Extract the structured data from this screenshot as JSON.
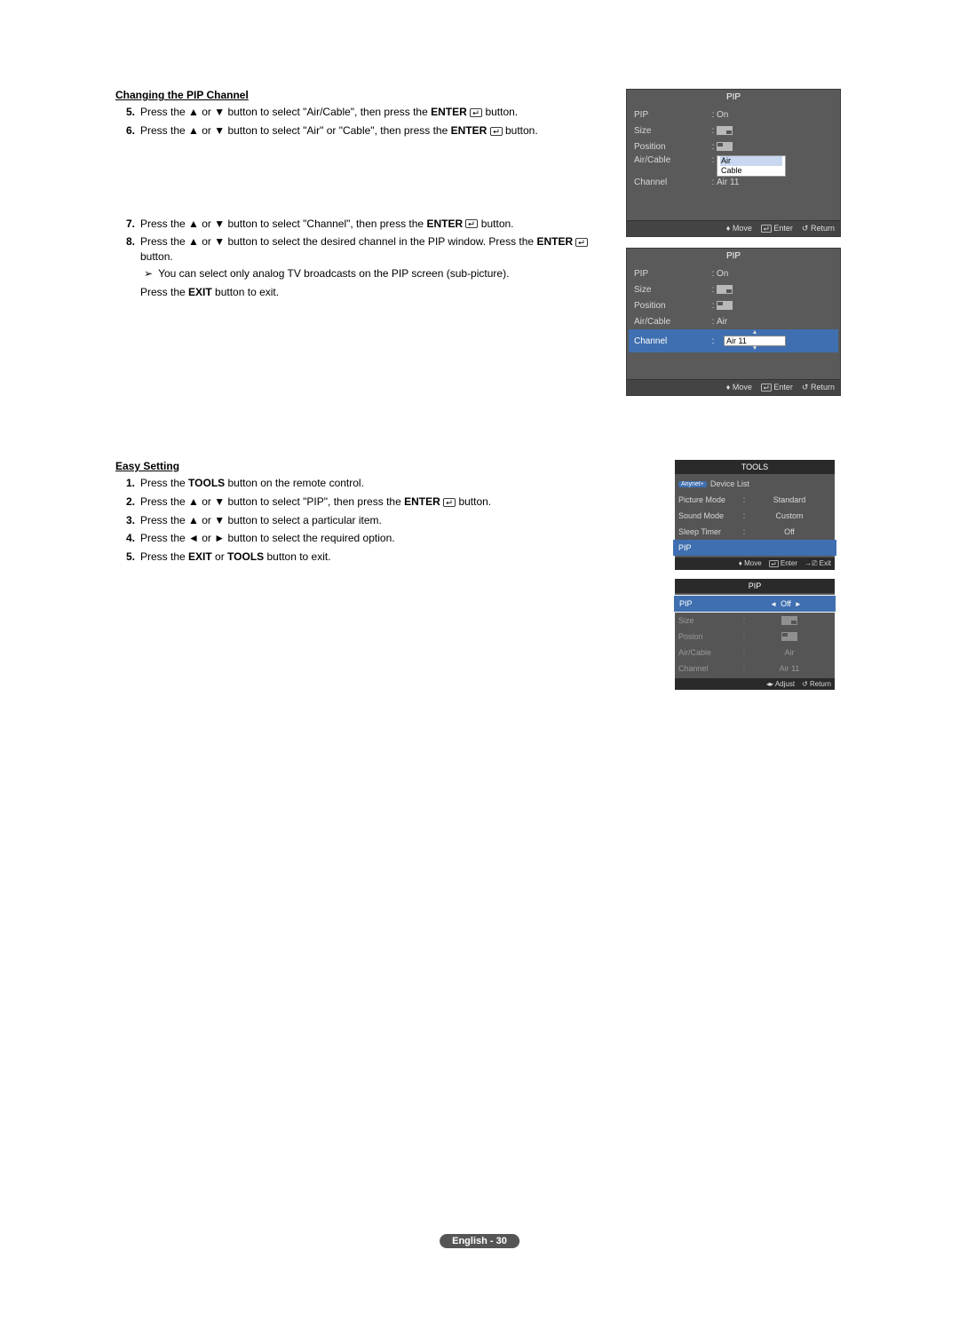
{
  "section1": {
    "title": "Changing the PIP Channel",
    "steps5_8": {
      "s5": {
        "num": "5.",
        "text_a": "Press the ▲ or ▼ button to select \"Air/Cable\", then press the ",
        "text_b": "ENTER",
        "text_c": " button."
      },
      "s6": {
        "num": "6.",
        "text_a": "Press the ▲ or ▼ button to select \"Air\" or \"Cable\", then press the ",
        "text_b": "ENTER",
        "text_c": " button."
      },
      "s7": {
        "num": "7.",
        "text_a": "Press the ▲ or ▼ button to select \"Channel\", then press the ",
        "text_b": "ENTER",
        "text_c": " button."
      },
      "s8": {
        "num": "8.",
        "line1_a": "Press the ▲ or ▼ button to select the desired channel in the PIP window. Press the ",
        "line1_b": "ENTER",
        "line1_c": "  button.",
        "note_mark": "➢",
        "note": "You can select only analog TV broadcasts on the PIP screen (sub-picture).",
        "exit_a": "Press the ",
        "exit_b": "EXIT",
        "exit_c": " button to exit."
      }
    }
  },
  "section2": {
    "title": "Easy Setting",
    "s1": {
      "num": "1.",
      "a": "Press the ",
      "b": "TOOLS",
      "c": " button on the remote control."
    },
    "s2": {
      "num": "2.",
      "a": "Press the ▲ or ▼ button to select \"PIP\", then press the ",
      "b": "ENTER",
      "c": "  button."
    },
    "s3": {
      "num": "3.",
      "a": "Press the ▲ or ▼ button to select a particular item."
    },
    "s4": {
      "num": "4.",
      "a": "Press the ◄ or ► button to select the required option."
    },
    "s5": {
      "num": "5.",
      "a": "Press the ",
      "b": "EXIT",
      "c": " or ",
      "d": "TOOLS",
      "e": " button to exit."
    }
  },
  "osd_a": {
    "title": "PIP",
    "rows": {
      "pip": {
        "label": "PIP",
        "val": "On"
      },
      "size": {
        "label": "Size",
        "val": ""
      },
      "position": {
        "label": "Position",
        "val": ""
      },
      "aircable": {
        "label": "Air/Cable",
        "dd_air": "Air",
        "dd_cable": "Cable"
      },
      "channel": {
        "label": "Channel",
        "val": "Air 11"
      }
    },
    "foot": {
      "move": "Move",
      "enter": "Enter",
      "return": "Return"
    }
  },
  "osd_b": {
    "title": "PIP",
    "rows": {
      "pip": {
        "label": "PIP",
        "val": "On"
      },
      "size": {
        "label": "Size",
        "val": ""
      },
      "position": {
        "label": "Position",
        "val": ""
      },
      "aircable": {
        "label": "Air/Cable",
        "val": "Air"
      },
      "channel": {
        "label": "Channel",
        "spin_val": "Air 11"
      }
    },
    "foot": {
      "move": "Move",
      "enter": "Enter",
      "return": "Return"
    }
  },
  "tools": {
    "title": "TOOLS",
    "anynet_badge": "Anynet+",
    "device_list": "Device List",
    "picture_mode": {
      "label": "Picture Mode",
      "val": "Standard"
    },
    "sound_mode": {
      "label": "Sound Mode",
      "val": "Custom"
    },
    "sleep_timer": {
      "label": "Sleep Timer",
      "val": "Off"
    },
    "pip": {
      "label": "PIP"
    },
    "foot": {
      "move": "Move",
      "enter": "Enter",
      "exit": "Exit"
    }
  },
  "osd_c": {
    "title": "PIP",
    "rows": {
      "pip": {
        "label": "PIP",
        "val": "Off"
      },
      "size": {
        "label": "Size"
      },
      "position": {
        "label": "Posion"
      },
      "aircable": {
        "label": "Air/Cable",
        "val": "Air"
      },
      "channel": {
        "label": "Channel",
        "val": "Air 11"
      }
    },
    "foot": {
      "adjust": "Adjust",
      "return": "Return"
    }
  },
  "footer": "English - 30"
}
